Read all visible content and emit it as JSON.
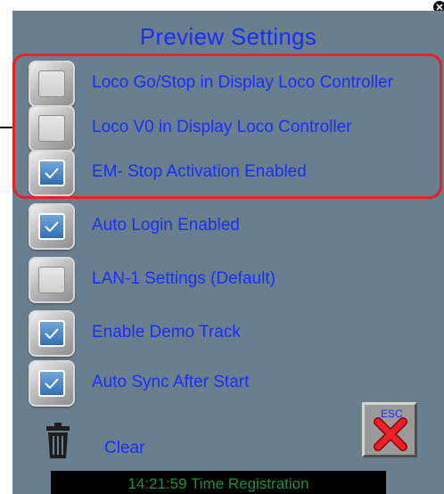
{
  "dialog": {
    "title": "Preview Settings",
    "items": [
      {
        "label": "Loco Go/Stop in Display Loco Controller",
        "checked": false
      },
      {
        "label": "Loco V0 in Display Loco Controller",
        "checked": false
      },
      {
        "label": "EM- Stop Activation Enabled",
        "checked": true
      },
      {
        "label": "Auto Login Enabled",
        "checked": true
      },
      {
        "label": "LAN-1 Settings (Default)",
        "checked": false
      },
      {
        "label": "Enable Demo Track",
        "checked": true
      },
      {
        "label": "Auto Sync After Start",
        "checked": true
      }
    ],
    "clear_label": "Clear",
    "esc_label": "ESC"
  },
  "status_bar": {
    "text": "14:21:59 Time Registration"
  },
  "colors": {
    "panel": "#6a7f8e",
    "text_accent": "#1a2dff",
    "highlight": "#e8202a",
    "status_text": "#1a8f3a"
  },
  "icons": [
    "checkbox-icon",
    "check-mark-icon",
    "trash-icon",
    "close-x-icon"
  ]
}
